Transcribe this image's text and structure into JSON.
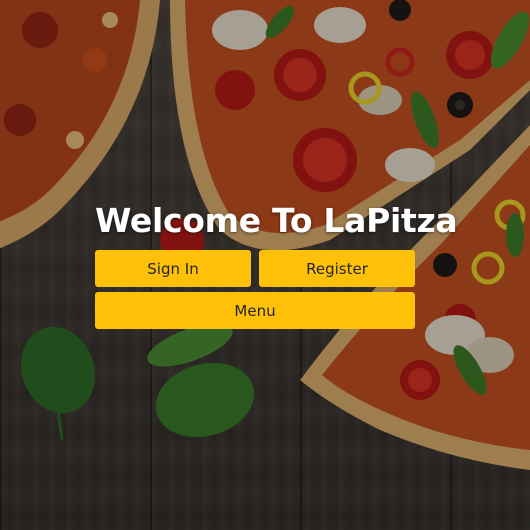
{
  "hero": {
    "title": "Welcome To LaPitza"
  },
  "buttons": {
    "sign_in": "Sign In",
    "register": "Register",
    "menu": "Menu"
  },
  "colors": {
    "button_background": "#ffc107",
    "button_text": "#212529",
    "title_text": "#ffffff"
  }
}
